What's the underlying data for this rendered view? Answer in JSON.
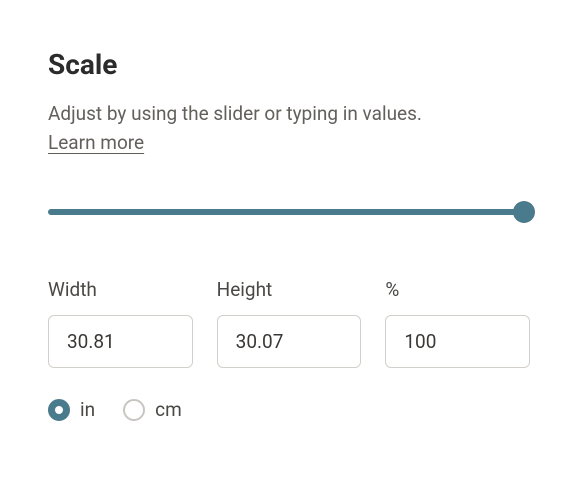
{
  "header": {
    "title": "Scale",
    "description": "Adjust by using the slider or typing in values.",
    "learn_more": "Learn more"
  },
  "slider": {
    "value": 100,
    "min": 0,
    "max": 100
  },
  "fields": {
    "width": {
      "label": "Width",
      "value": "30.81"
    },
    "height": {
      "label": "Height",
      "value": "30.07"
    },
    "percent": {
      "label": "%",
      "value": "100"
    }
  },
  "units": {
    "in": {
      "label": "in",
      "selected": true
    },
    "cm": {
      "label": "cm",
      "selected": false
    }
  }
}
